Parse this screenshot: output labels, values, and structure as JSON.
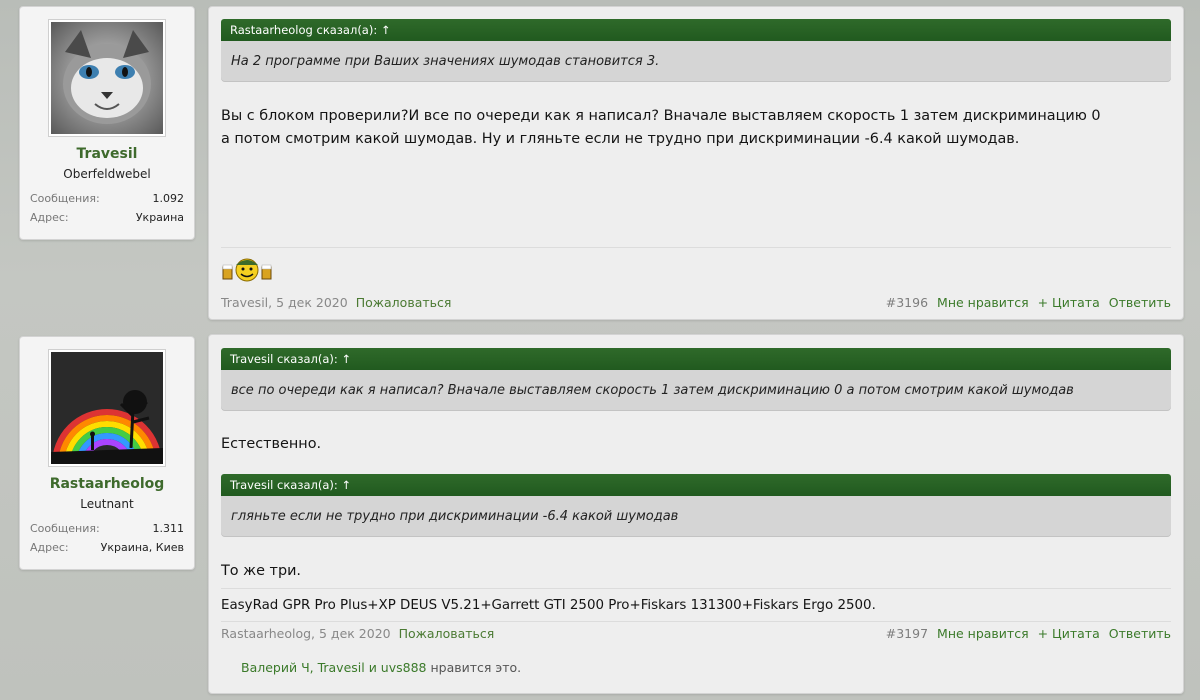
{
  "post1": {
    "user": {
      "name": "Travesil",
      "title": "Oberfeldwebel",
      "messages_label": "Сообщения:",
      "messages_value": "1.092",
      "address_label": "Адрес:",
      "address_value": "Украина"
    },
    "quote": {
      "header": "Rastaarheolog сказал(а): ↑",
      "text": "На 2 программе при Ваших значениях шумодав становится 3."
    },
    "body_lines": [
      "Вы с блоком проверили?И все по очереди как я написал? Вначале выставляем скорость 1 затем дискриминацию 0",
      "а потом смотрим какой шумодав. Ну и гляньте если не трудно при дискриминации -6.4 какой шумодав."
    ],
    "meta": {
      "author": "Travesil",
      "sep": ", ",
      "date": "5 дек 2020",
      "report": "Пожаловаться",
      "number": "#3196",
      "like": "Мне нравится",
      "quote": "+ Цитата",
      "reply": "Ответить"
    }
  },
  "post2": {
    "user": {
      "name": "Rastaarheolog",
      "title": "Leutnant",
      "messages_label": "Сообщения:",
      "messages_value": "1.311",
      "address_label": "Адрес:",
      "address_value": "Украина, Киев"
    },
    "quote1": {
      "header": "Travesil сказал(а): ↑",
      "text": "все по очереди как я написал? Вначале выставляем скорость 1 затем дискриминацию 0 а потом смотрим какой шумодав"
    },
    "reply1": "Естественно.",
    "quote2": {
      "header": "Travesil сказал(а): ↑",
      "text": "гляньте если не трудно при дискриминации -6.4 какой шумодав"
    },
    "reply2": "То же три.",
    "signature": "EasyRad GPR Pro Plus+XP DEUS V5.21+Garrett GTI 2500 Pro+Fiskars 131300+Fiskars Ergo 2500.",
    "meta": {
      "author": "Rastaarheolog",
      "sep": ", ",
      "date": "5 дек 2020",
      "report": "Пожаловаться",
      "number": "#3197",
      "like": "Мне нравится",
      "quote": "+ Цитата",
      "reply": "Ответить"
    },
    "likes": {
      "users": "Валерий Ч, Travesil и uvs888",
      "suffix": " нравится это."
    }
  }
}
